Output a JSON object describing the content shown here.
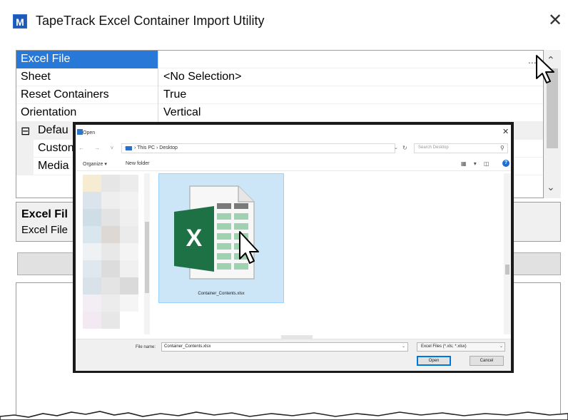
{
  "window": {
    "title": "TapeTrack Excel Container Import Utility",
    "app_icon_letter": "M",
    "close_glyph": "✕"
  },
  "property_grid": {
    "rows": [
      {
        "name": "Excel File",
        "value": ""
      },
      {
        "name": "Sheet",
        "value": "<No Selection>"
      },
      {
        "name": "Reset Containers",
        "value": "True"
      },
      {
        "name": "Orientation",
        "value": "Vertical"
      },
      {
        "name": "Defau",
        "expander": "⊟"
      },
      {
        "name": "Custon",
        "value": ""
      },
      {
        "name": "Media",
        "value": ""
      }
    ],
    "ellipsis": "..."
  },
  "description": {
    "title": "Excel Fil",
    "text": "Excel File"
  },
  "open_dialog": {
    "title": "Open",
    "close_glyph": "✕",
    "nav_arrows": "← → ˅ ↑",
    "address": "› This PC › Desktop",
    "search_placeholder": "Search Desktop",
    "organize_label": "Organize ▾",
    "new_folder_label": "New folder",
    "view_icons": "▦ ▾ ◫",
    "help_glyph": "?",
    "file": {
      "name": "Container_Contents.xlsx",
      "icon_letter": "X"
    },
    "file_name_label": "File name:",
    "file_name_value": "Container_Contents.xlsx",
    "file_type_value": "Excel Files (*.xls; *.xlsx)",
    "open_label": "Open",
    "cancel_label": "Cancel"
  },
  "colors": {
    "selection": "#2878d8",
    "tile_selected": "#cde6f7",
    "excel_green": "#1e7145",
    "button_focus": "#0078d7"
  }
}
